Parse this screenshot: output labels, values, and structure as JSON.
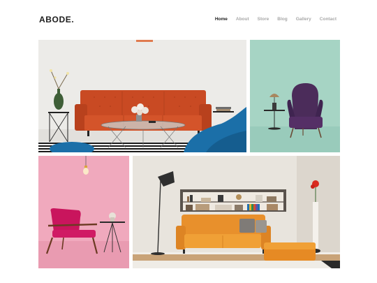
{
  "brand": {
    "logo": "ABODE."
  },
  "nav": {
    "items": [
      {
        "label": "Home",
        "active": true
      },
      {
        "label": "About",
        "active": false
      },
      {
        "label": "Store",
        "active": false
      },
      {
        "label": "Blog",
        "active": false
      },
      {
        "label": "Gallery",
        "active": false
      },
      {
        "label": "Contact",
        "active": false
      }
    ]
  },
  "gallery": {
    "images": [
      {
        "subject": "orange tufted sofa with glass coffee table",
        "background": "#ecebe8"
      },
      {
        "subject": "purple wingback armchair with side lamp",
        "background": "#a6d4c4"
      },
      {
        "subject": "magenta armchair with side table",
        "background": "#f0a9bd"
      },
      {
        "subject": "orange sofa with ottoman and bookshelf",
        "background": "#e8e4dd"
      }
    ]
  },
  "colors": {
    "text_dark": "#1c1c1c",
    "text_muted": "#a8a8a8"
  }
}
